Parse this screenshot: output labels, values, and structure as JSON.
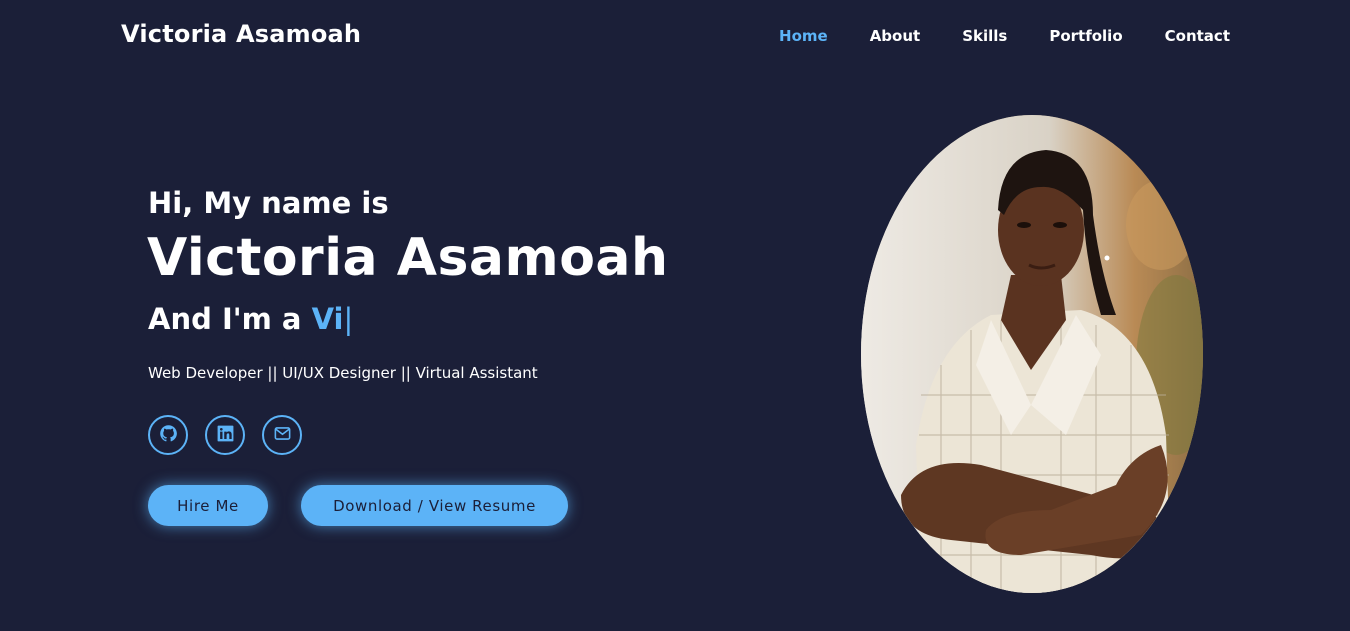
{
  "brand": "Victoria Asamoah",
  "nav": {
    "items": [
      "Home",
      "About",
      "Skills",
      "Portfolio",
      "Contact"
    ],
    "active": "Home"
  },
  "hero": {
    "greeting": "Hi, My name is",
    "name": "Victoria Asamoah",
    "role_prefix": "And I'm a",
    "role_typed": "Vi",
    "cursor": "|",
    "tagline": "Web Developer || UI/UX Designer || Virtual Assistant"
  },
  "socials": [
    {
      "icon": "github-icon"
    },
    {
      "icon": "linkedin-icon"
    },
    {
      "icon": "mail-icon"
    }
  ],
  "buttons": {
    "hire": "Hire Me",
    "resume": "Download / View Resume"
  },
  "colors": {
    "background": "#1b1f38",
    "accent": "#5cb3f7",
    "text": "#ffffff"
  }
}
